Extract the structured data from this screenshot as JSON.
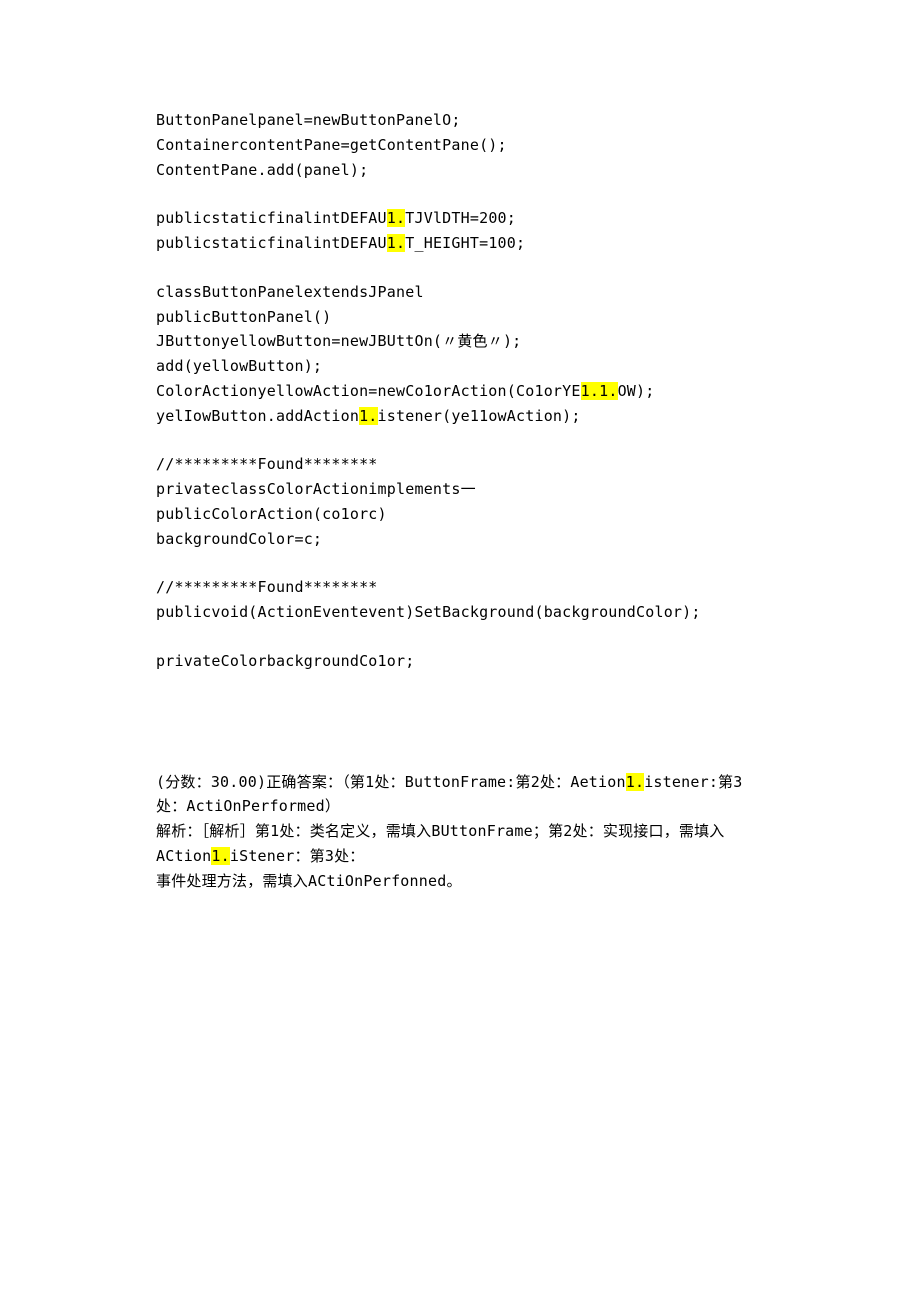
{
  "code": {
    "l1": "ButtonPanelpanel=newButtonPanelO;",
    "l2": "ContainercontentPane=getContentPane();",
    "l3": "ContentPane.add(panel);",
    "l4a": "publicstaticfinalintDEFAU",
    "l4b": "1.",
    "l4c": "TJVlDTH=200;",
    "l5a": "publicstaticfinalintDEFAU",
    "l5b": "1.",
    "l5c": "T_HEIGHT=100;",
    "l6": "classButtonPanelextendsJPanel",
    "l7": "publicButtonPanel()",
    "l8": "JButtonyellowButton=newJBUttOn(〃黄色〃);",
    "l9": "add(yellowButton);",
    "l10a": "ColorActionyellowAction=newCo1orAction(Co1orYE",
    "l10b": "1.1.",
    "l10c": "OW);",
    "l11a": "yelIowButton.addAction",
    "l11b": "1.",
    "l11c": "istener(ye11owAction);",
    "l12": "∕∕*********Found********",
    "l13": "privateclassColorActionimplements一",
    "l14": "publicColorAction(co1orc)",
    "l15": "backgroundColor=c;",
    "l16": "∕∕*********Found********",
    "l17": "publicvoid(ActionEventevent)SetBackground(backgroundColor);",
    "l18": "privateColorbackgroundCo1or;"
  },
  "answer": {
    "p1a": "(分数：30.00)正确答案：（第1处：ButtonFrame:第2处：Aetion",
    "p1b": "1.",
    "p1c": "istener:第3处：ActiOnPerformed）",
    "p2a": "解析：［解析］第1处：类名定义，需填入BUttonFrame；第2处：实现接口，需填入ACtion",
    "p2b": "1.",
    "p2c": "iStener：第3处：",
    "p3": "事件处理方法，需填入ACtiOnPerfonned。"
  }
}
